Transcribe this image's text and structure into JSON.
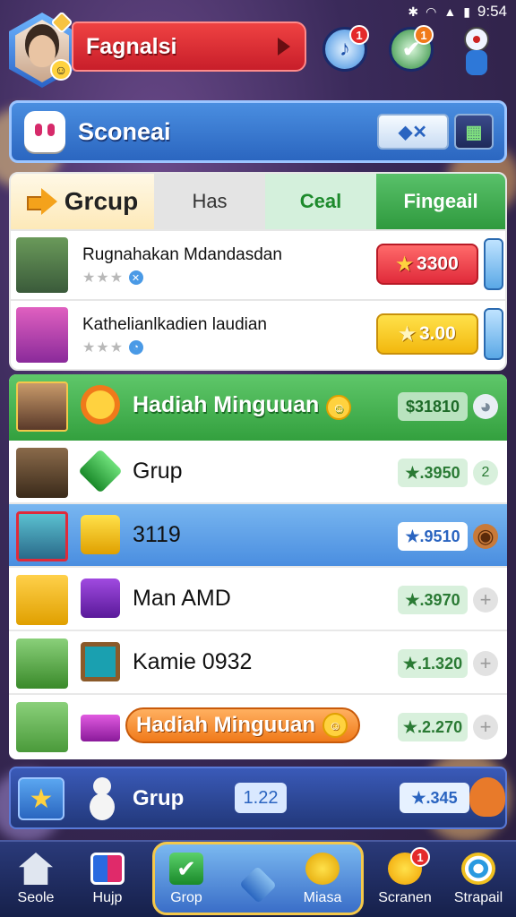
{
  "status": {
    "time": "9:54"
  },
  "header": {
    "player_name": "Fagnalsi",
    "music_badge": "1",
    "check_badge": "1"
  },
  "title_bar": {
    "title": "Sconeai"
  },
  "tabs": [
    "Grcup",
    "Has",
    "Ceal",
    "Fingeail"
  ],
  "featured": [
    {
      "name": "Rugnahakan Mdandasdan",
      "price": "3300",
      "style": "red"
    },
    {
      "name": "Kathelianlkadien laudian",
      "price": "3.00",
      "style": "yellow"
    }
  ],
  "leaderboard": {
    "header": {
      "name": "Hadiah Minguuan",
      "score": "$31810"
    },
    "rows": [
      {
        "name": "Grup",
        "score": "3950",
        "extra": "2"
      },
      {
        "name": "3119",
        "score": "9510",
        "selected": true
      },
      {
        "name": "Man AMD",
        "score": "3970"
      },
      {
        "name": "Kamie 0932",
        "score": "1.320"
      },
      {
        "name": "Hadiah Minguuan",
        "score": "2.270",
        "pill": true
      }
    ]
  },
  "footer_row": {
    "name": "Grup",
    "pill": "1.22",
    "score": "345"
  },
  "bottom_nav": [
    {
      "label": "Seole",
      "icon": "home-icon"
    },
    {
      "label": "Hujp",
      "icon": "card-icon"
    },
    {
      "label": "Grop",
      "icon": "check-icon",
      "active": true
    },
    {
      "label": "Miasa",
      "icon": "coin-icon",
      "active": true
    },
    {
      "label": "Scranen",
      "icon": "smiley-icon",
      "badge": "1"
    },
    {
      "label": "Strapail",
      "icon": "target-icon"
    }
  ],
  "colors": {
    "accent": "#2b66c0",
    "header_green": "#33a03e",
    "banner_red": "#c81e2a",
    "active_border": "#f4c84a"
  }
}
